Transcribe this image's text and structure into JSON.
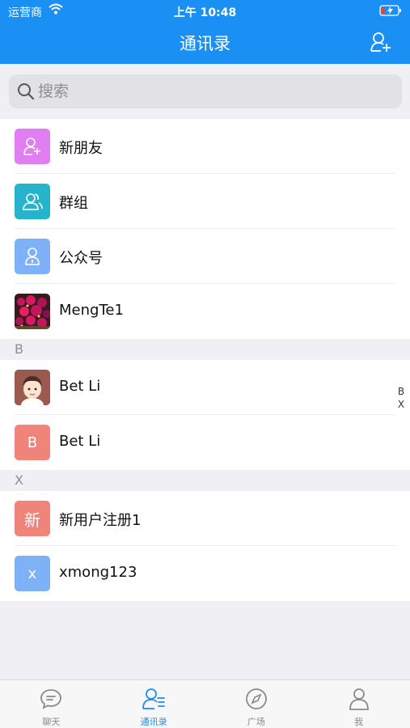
{
  "status_bar": {
    "carrier": "运营商",
    "time": "上午 10:48"
  },
  "nav": {
    "title": "通讯录",
    "add_icon": "add-contact-icon"
  },
  "search": {
    "placeholder": "搜索",
    "value": ""
  },
  "top_items": [
    {
      "label": "新朋友",
      "icon": "add-user-icon",
      "color": "#e17ef2"
    },
    {
      "label": "群组",
      "icon": "group-icon",
      "color": "#26b4cc"
    },
    {
      "label": "公众号",
      "icon": "official-account-icon",
      "color": "#7fb1f7"
    },
    {
      "label": "MengTe1",
      "icon": "flower-photo-avatar"
    }
  ],
  "sections": [
    {
      "letter": "B",
      "contacts": [
        {
          "name": "Bet Li",
          "avatar": "cartoon-face-avatar"
        },
        {
          "name": "Bet Li",
          "initial": "B",
          "color": "#f0837a"
        }
      ]
    },
    {
      "letter": "X",
      "contacts": [
        {
          "name": "新用户注册1",
          "initial": "新",
          "color": "#f0837a"
        },
        {
          "name": "xmong123",
          "initial": "x",
          "color": "#7fb1f7"
        }
      ]
    }
  ],
  "index_bar": [
    "B",
    "X"
  ],
  "tab_bar": {
    "active": 1,
    "tabs": [
      {
        "label": "聊天",
        "icon": "chat-bubble-icon"
      },
      {
        "label": "通讯录",
        "icon": "contacts-icon"
      },
      {
        "label": "广场",
        "icon": "compass-icon"
      },
      {
        "label": "我",
        "icon": "person-icon"
      }
    ]
  },
  "colors": {
    "brand": "#1a90f4",
    "background": "#efeff4"
  }
}
